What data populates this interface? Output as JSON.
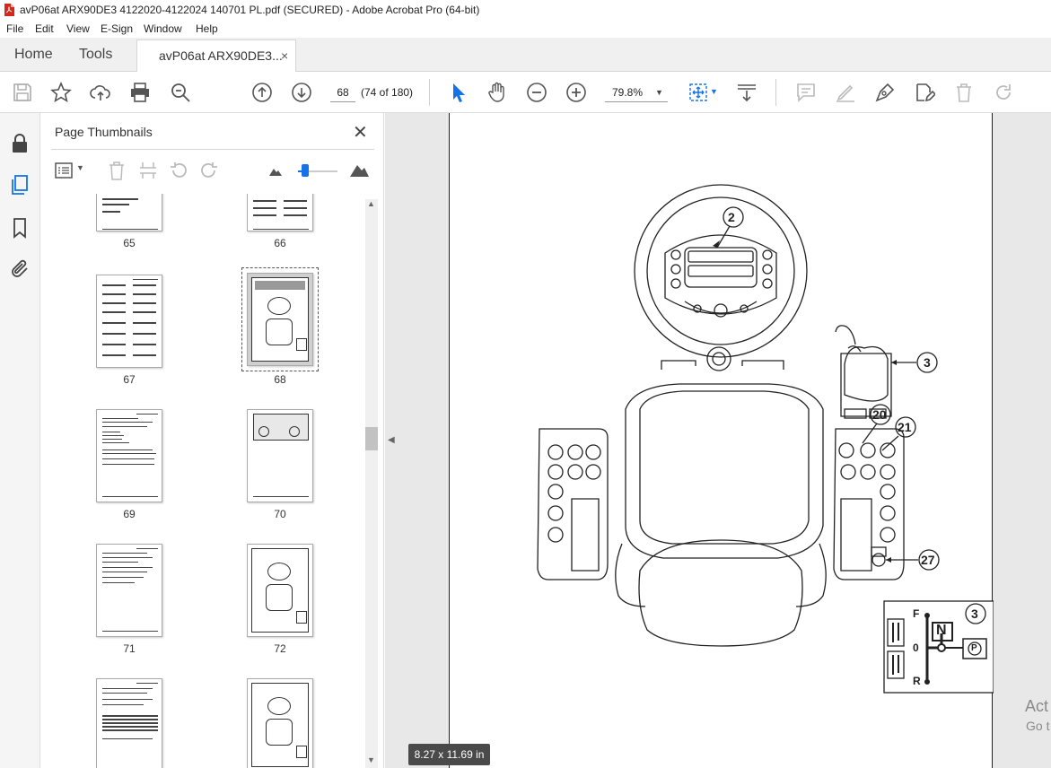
{
  "window": {
    "title": "avP06at ARX90DE3 4122020-4122024 140701 PL.pdf (SECURED) - Adobe Acrobat Pro (64-bit)"
  },
  "menu": [
    "File",
    "Edit",
    "View",
    "E-Sign",
    "Window",
    "Help"
  ],
  "tabs": {
    "home": "Home",
    "tools": "Tools",
    "document": "avP06at ARX90DE3...",
    "close": "×"
  },
  "toolbar": {
    "page_number": "68",
    "page_count": "(74 of 180)",
    "zoom": "79.8%"
  },
  "thumbnails": {
    "title": "Page Thumbnails",
    "close": "✕",
    "pages": [
      "65",
      "66",
      "67",
      "68",
      "69",
      "70",
      "71",
      "72"
    ],
    "selected": "68"
  },
  "document": {
    "page_size": "8.27 x 11.69 in",
    "callouts": [
      "2",
      "3",
      "20",
      "21",
      "27"
    ],
    "shift_diagram": {
      "badge": "3",
      "labels": [
        "F",
        "0",
        "R"
      ],
      "neutral": "N",
      "park": "P"
    }
  },
  "watermark": {
    "line1": "Act",
    "line2": "Go t"
  },
  "colors": {
    "accent": "#1473e6",
    "pdf_red": "#d5281b",
    "size_badge_bg": "#4a4a4a"
  }
}
